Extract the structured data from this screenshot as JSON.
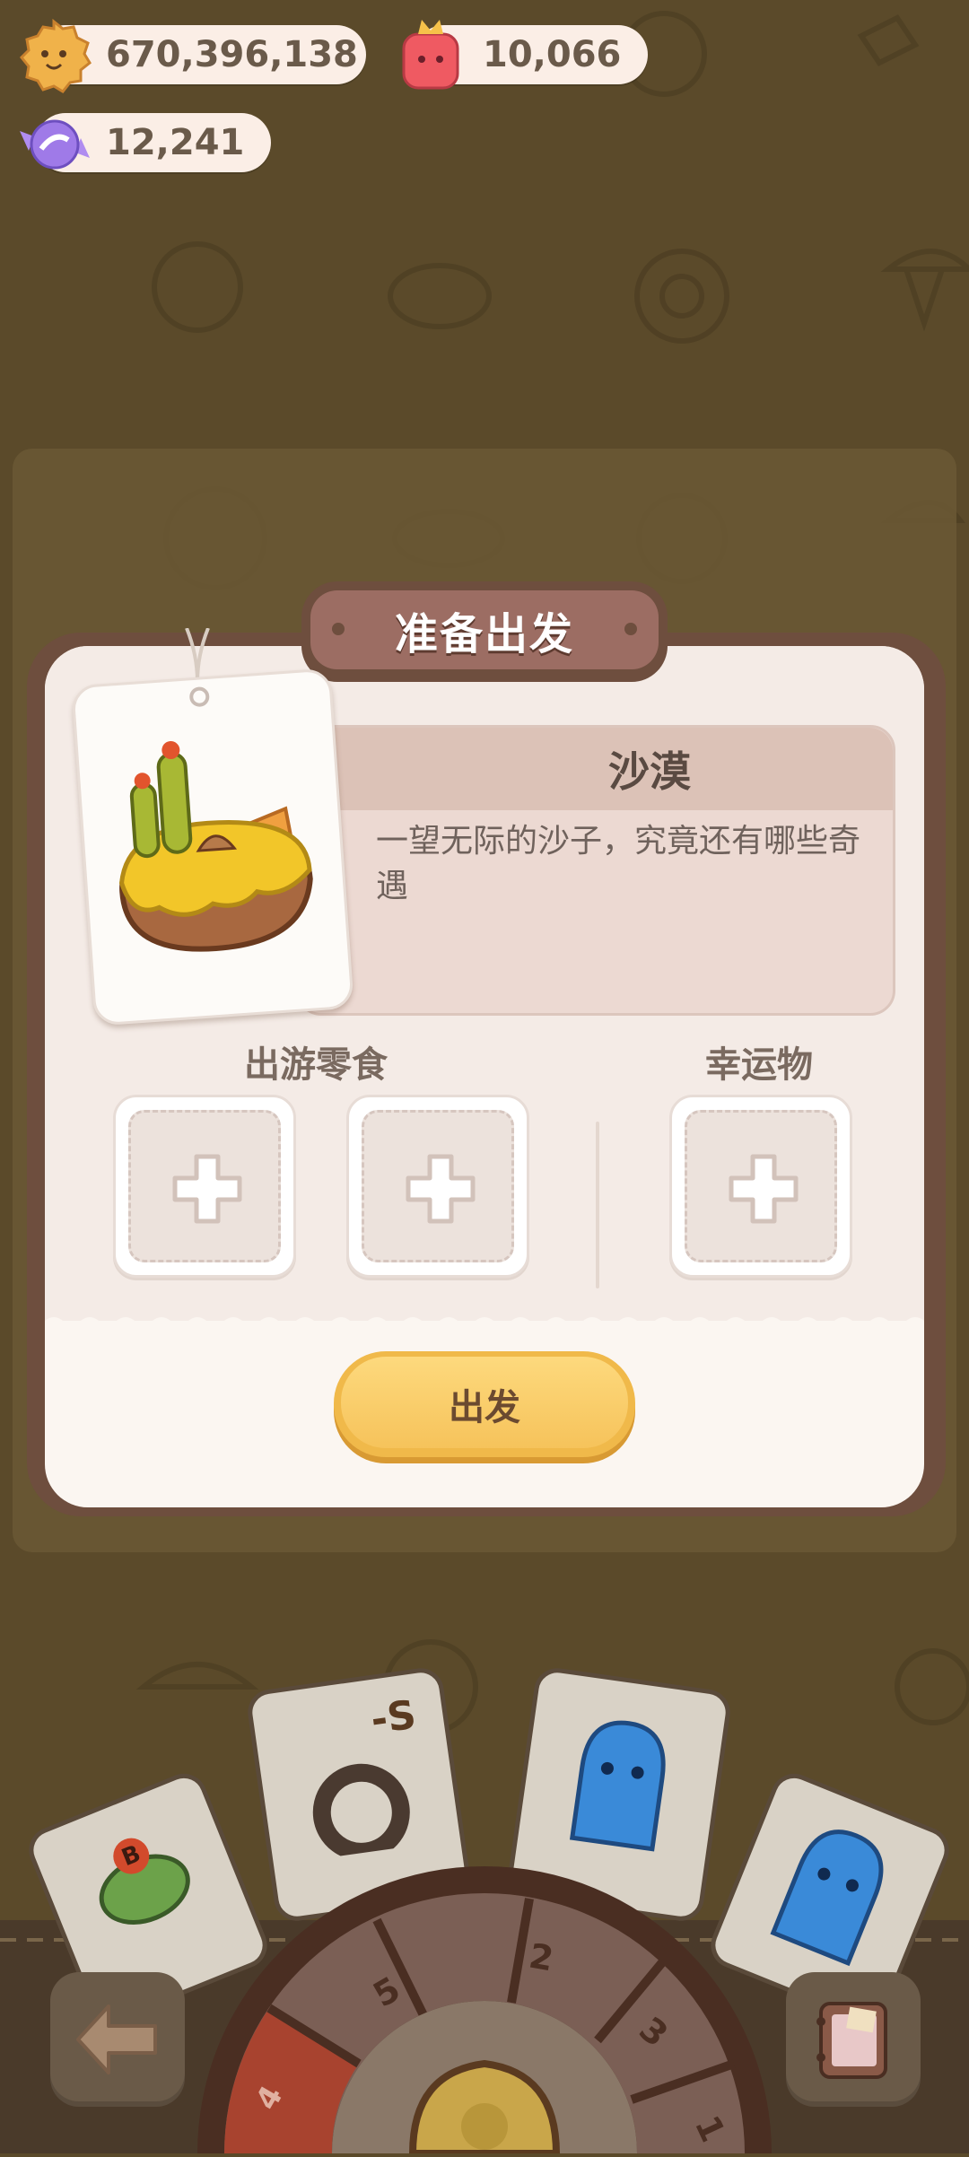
{
  "currencies": {
    "cookies": {
      "value": "670,396,138",
      "icon": "cookie-icon"
    },
    "gems": {
      "value": "10,066",
      "icon": "jelly-gem-icon"
    },
    "candy": {
      "value": "12,241",
      "icon": "candy-icon"
    }
  },
  "modal": {
    "title": "准备出发",
    "location_name": "沙漠",
    "location_desc": "一望无际的沙子，究竟还有哪些奇遇",
    "snacks_label": "出游零食",
    "lucky_label": "幸运物",
    "go_label": "出发"
  },
  "dial": {
    "segments": [
      "4",
      "5",
      "2",
      "3",
      "1"
    ],
    "active_segment": "4",
    "colors": {
      "active": "#a8432f",
      "inactive": "#7b5f55"
    }
  },
  "cards": [
    {
      "label": "B",
      "icon": "donut-card-icon"
    },
    {
      "label": "-S",
      "icon": "ring-card-icon"
    },
    {
      "label": "",
      "icon": "blue-ghost-card-icon"
    },
    {
      "label": "",
      "icon": "blue-ghost-card-icon"
    }
  ],
  "colors": {
    "background": "#5b4a2a",
    "modal": "#fbf6f1",
    "accent_button": "#f6c35b",
    "title_plate": "#9c6d63"
  }
}
